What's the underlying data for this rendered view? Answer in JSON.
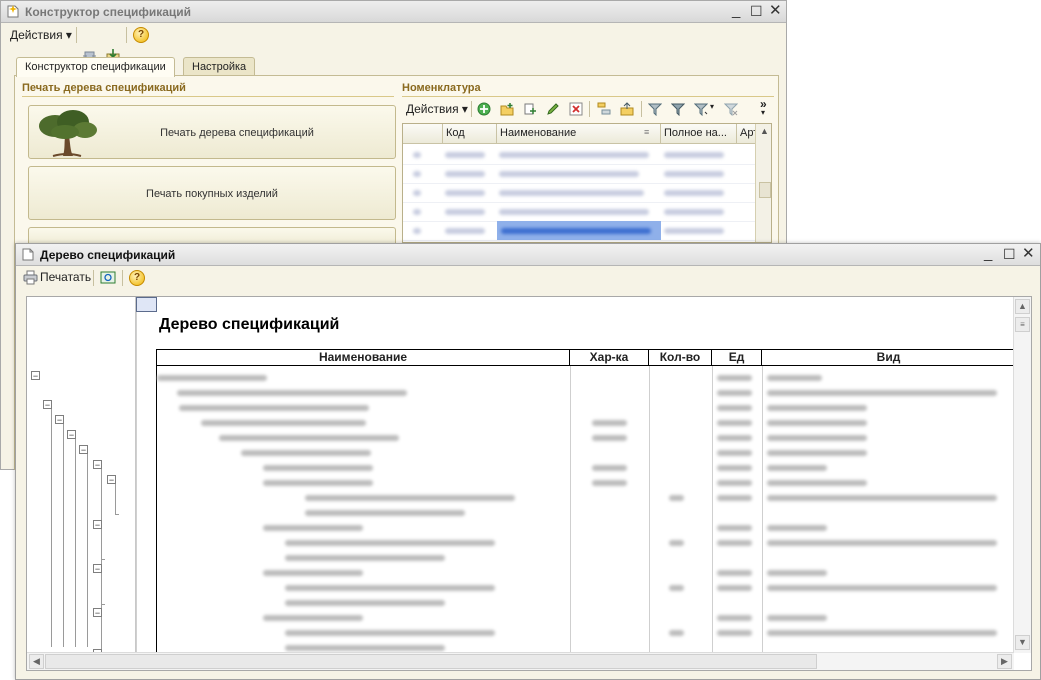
{
  "back_window": {
    "title": "Конструктор спецификаций",
    "toolbar": {
      "actions_label": "Действия ▾"
    },
    "tabs": [
      {
        "label": "Конструктор спецификации",
        "active": true
      },
      {
        "label": "Настройка",
        "active": false
      }
    ],
    "left_section": {
      "title": "Печать дерева спецификаций",
      "buttons": [
        "Печать дерева спецификаций",
        "Печать покупных изделий"
      ]
    },
    "nomenclature": {
      "title": "Номенклатура",
      "actions_label": "Действия ▾",
      "more_label": "»",
      "columns": [
        "Код",
        "Наименование",
        "Полное на...",
        "Арт"
      ]
    }
  },
  "front_window": {
    "title": "Дерево спецификаций",
    "toolbar": {
      "print_label": "Печатать"
    },
    "report": {
      "title": "Дерево спецификаций",
      "columns": [
        "Наименование",
        "Хар-ка",
        "Кол-во",
        "Ед",
        "Вид"
      ]
    }
  },
  "colors": {
    "section_title": "#8a6a1f",
    "window_bg": "#f6f3e6",
    "selection": "#3d6fd0"
  },
  "icons": [
    "document-icon",
    "help-icon",
    "printer-icon",
    "tree-picture-icon",
    "add-icon",
    "filter-icon",
    "delete-icon",
    "edit-icon"
  ]
}
